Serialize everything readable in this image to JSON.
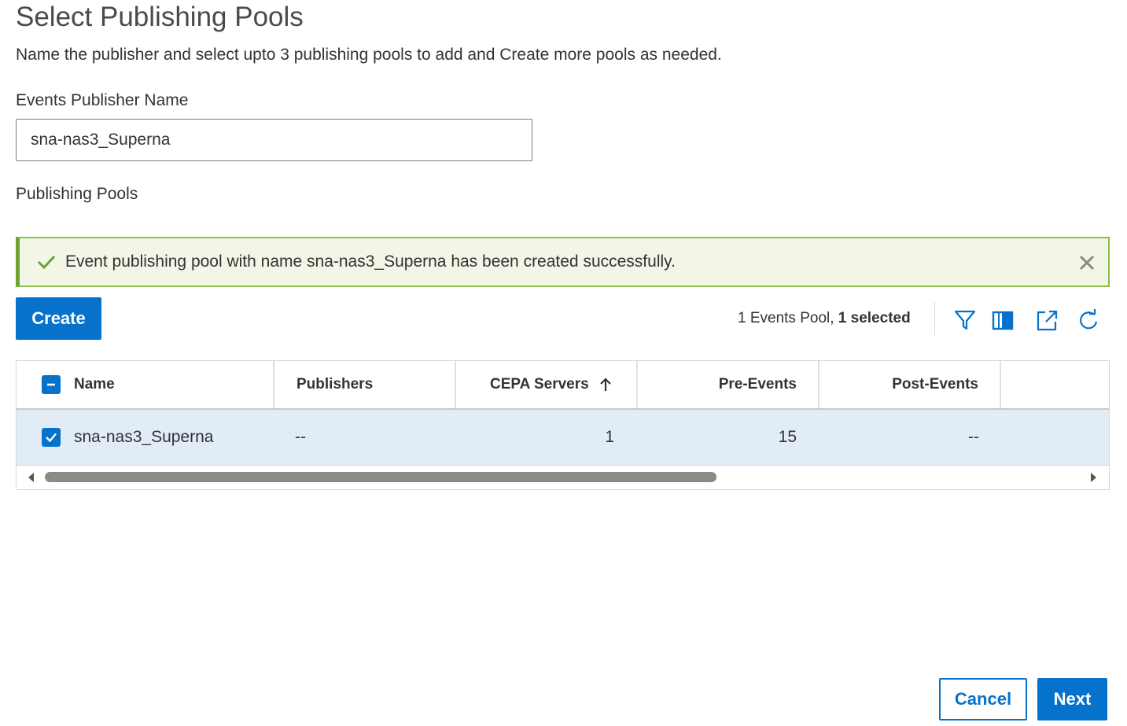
{
  "page": {
    "title": "Select Publishing Pools",
    "subtitle": "Name the publisher and select upto 3 publishing pools to add and Create more pools as needed."
  },
  "publisher": {
    "label": "Events Publisher Name",
    "value": "sna-nas3_Superna"
  },
  "pools": {
    "label": "Publishing Pools"
  },
  "alert": {
    "type": "success",
    "message": "Event publishing pool with name sna-nas3_Superna has been created successfully.",
    "icon": "check-icon",
    "close_icon": "close-icon"
  },
  "toolbar": {
    "create_label": "Create",
    "summary_count": "1 Events Pool, ",
    "summary_selected": "1 selected",
    "icons": [
      "filter-icon",
      "columns-icon",
      "export-icon",
      "refresh-icon"
    ]
  },
  "table": {
    "columns": {
      "name": "Name",
      "publishers": "Publishers",
      "cepa_servers": "CEPA Servers",
      "pre_events": "Pre-Events",
      "post_events": "Post-Events"
    },
    "sort": {
      "column": "CEPA Servers",
      "direction": "ascending"
    },
    "rows": [
      {
        "selected": true,
        "name": "sna-nas3_Superna",
        "publishers": "--",
        "cepa_servers": "1",
        "pre_events": "15",
        "post_events": "--"
      }
    ]
  },
  "footer": {
    "cancel_label": "Cancel",
    "next_label": "Next"
  },
  "colors": {
    "primary": "#0672cb",
    "success_border": "#8cbf48",
    "success_bg": "#f1f6e6",
    "selected_row": "#e1ecf7"
  }
}
